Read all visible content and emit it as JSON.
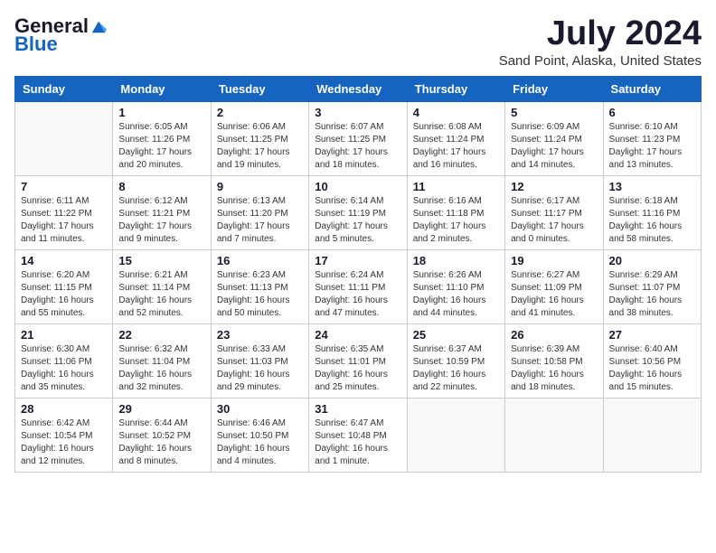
{
  "logo": {
    "general": "General",
    "blue": "Blue"
  },
  "title": "July 2024",
  "subtitle": "Sand Point, Alaska, United States",
  "days_of_week": [
    "Sunday",
    "Monday",
    "Tuesday",
    "Wednesday",
    "Thursday",
    "Friday",
    "Saturday"
  ],
  "weeks": [
    [
      {
        "day": "",
        "info": ""
      },
      {
        "day": "1",
        "info": "Sunrise: 6:05 AM\nSunset: 11:26 PM\nDaylight: 17 hours\nand 20 minutes."
      },
      {
        "day": "2",
        "info": "Sunrise: 6:06 AM\nSunset: 11:25 PM\nDaylight: 17 hours\nand 19 minutes."
      },
      {
        "day": "3",
        "info": "Sunrise: 6:07 AM\nSunset: 11:25 PM\nDaylight: 17 hours\nand 18 minutes."
      },
      {
        "day": "4",
        "info": "Sunrise: 6:08 AM\nSunset: 11:24 PM\nDaylight: 17 hours\nand 16 minutes."
      },
      {
        "day": "5",
        "info": "Sunrise: 6:09 AM\nSunset: 11:24 PM\nDaylight: 17 hours\nand 14 minutes."
      },
      {
        "day": "6",
        "info": "Sunrise: 6:10 AM\nSunset: 11:23 PM\nDaylight: 17 hours\nand 13 minutes."
      }
    ],
    [
      {
        "day": "7",
        "info": "Sunrise: 6:11 AM\nSunset: 11:22 PM\nDaylight: 17 hours\nand 11 minutes."
      },
      {
        "day": "8",
        "info": "Sunrise: 6:12 AM\nSunset: 11:21 PM\nDaylight: 17 hours\nand 9 minutes."
      },
      {
        "day": "9",
        "info": "Sunrise: 6:13 AM\nSunset: 11:20 PM\nDaylight: 17 hours\nand 7 minutes."
      },
      {
        "day": "10",
        "info": "Sunrise: 6:14 AM\nSunset: 11:19 PM\nDaylight: 17 hours\nand 5 minutes."
      },
      {
        "day": "11",
        "info": "Sunrise: 6:16 AM\nSunset: 11:18 PM\nDaylight: 17 hours\nand 2 minutes."
      },
      {
        "day": "12",
        "info": "Sunrise: 6:17 AM\nSunset: 11:17 PM\nDaylight: 17 hours\nand 0 minutes."
      },
      {
        "day": "13",
        "info": "Sunrise: 6:18 AM\nSunset: 11:16 PM\nDaylight: 16 hours\nand 58 minutes."
      }
    ],
    [
      {
        "day": "14",
        "info": "Sunrise: 6:20 AM\nSunset: 11:15 PM\nDaylight: 16 hours\nand 55 minutes."
      },
      {
        "day": "15",
        "info": "Sunrise: 6:21 AM\nSunset: 11:14 PM\nDaylight: 16 hours\nand 52 minutes."
      },
      {
        "day": "16",
        "info": "Sunrise: 6:23 AM\nSunset: 11:13 PM\nDaylight: 16 hours\nand 50 minutes."
      },
      {
        "day": "17",
        "info": "Sunrise: 6:24 AM\nSunset: 11:11 PM\nDaylight: 16 hours\nand 47 minutes."
      },
      {
        "day": "18",
        "info": "Sunrise: 6:26 AM\nSunset: 11:10 PM\nDaylight: 16 hours\nand 44 minutes."
      },
      {
        "day": "19",
        "info": "Sunrise: 6:27 AM\nSunset: 11:09 PM\nDaylight: 16 hours\nand 41 minutes."
      },
      {
        "day": "20",
        "info": "Sunrise: 6:29 AM\nSunset: 11:07 PM\nDaylight: 16 hours\nand 38 minutes."
      }
    ],
    [
      {
        "day": "21",
        "info": "Sunrise: 6:30 AM\nSunset: 11:06 PM\nDaylight: 16 hours\nand 35 minutes."
      },
      {
        "day": "22",
        "info": "Sunrise: 6:32 AM\nSunset: 11:04 PM\nDaylight: 16 hours\nand 32 minutes."
      },
      {
        "day": "23",
        "info": "Sunrise: 6:33 AM\nSunset: 11:03 PM\nDaylight: 16 hours\nand 29 minutes."
      },
      {
        "day": "24",
        "info": "Sunrise: 6:35 AM\nSunset: 11:01 PM\nDaylight: 16 hours\nand 25 minutes."
      },
      {
        "day": "25",
        "info": "Sunrise: 6:37 AM\nSunset: 10:59 PM\nDaylight: 16 hours\nand 22 minutes."
      },
      {
        "day": "26",
        "info": "Sunrise: 6:39 AM\nSunset: 10:58 PM\nDaylight: 16 hours\nand 18 minutes."
      },
      {
        "day": "27",
        "info": "Sunrise: 6:40 AM\nSunset: 10:56 PM\nDaylight: 16 hours\nand 15 minutes."
      }
    ],
    [
      {
        "day": "28",
        "info": "Sunrise: 6:42 AM\nSunset: 10:54 PM\nDaylight: 16 hours\nand 12 minutes."
      },
      {
        "day": "29",
        "info": "Sunrise: 6:44 AM\nSunset: 10:52 PM\nDaylight: 16 hours\nand 8 minutes."
      },
      {
        "day": "30",
        "info": "Sunrise: 6:46 AM\nSunset: 10:50 PM\nDaylight: 16 hours\nand 4 minutes."
      },
      {
        "day": "31",
        "info": "Sunrise: 6:47 AM\nSunset: 10:48 PM\nDaylight: 16 hours\nand 1 minute."
      },
      {
        "day": "",
        "info": ""
      },
      {
        "day": "",
        "info": ""
      },
      {
        "day": "",
        "info": ""
      }
    ]
  ]
}
